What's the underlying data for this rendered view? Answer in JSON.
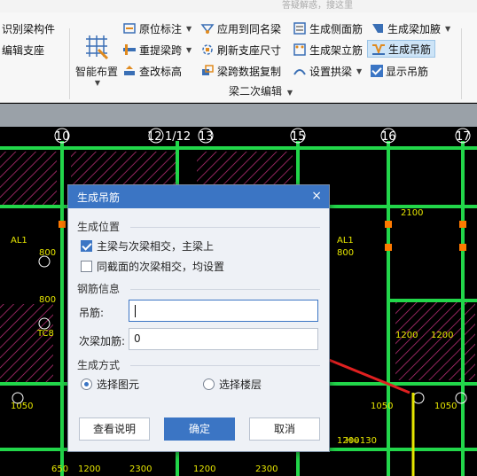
{
  "search": {
    "placeholder": "答疑解惑，搜这里"
  },
  "ribbon": {
    "left": {
      "row1": "识别梁构件",
      "row2": "编辑支座"
    },
    "big_button": "智能布置",
    "col2": [
      "原位标注",
      "重提梁跨",
      "查改标高"
    ],
    "col3": [
      "应用到同名梁",
      "刷新支座尺寸",
      "梁跨数据复制"
    ],
    "col4": [
      "生成侧面筋",
      "生成架立筋",
      "设置拱梁"
    ],
    "col5": [
      "生成梁加腋",
      "生成吊筋",
      "显示吊筋"
    ],
    "group_label": "梁二次编辑",
    "active_item": "生成吊筋"
  },
  "cad": {
    "axis_labels": [
      "10",
      "12",
      "1/12",
      "13",
      "15",
      "16",
      "17"
    ],
    "labels": [
      "AL1",
      "AL1",
      "800",
      "800",
      "800",
      "2100",
      "1050",
      "1050",
      "1200",
      "1200",
      "1050",
      "650",
      "1200",
      "2300",
      "1200",
      "2300",
      "H=130",
      "TC8",
      "1200"
    ],
    "colors": {
      "beam": "#22d64a",
      "hatch": "#c0307a",
      "text": "#e6e600",
      "axis": "#ffffff"
    }
  },
  "dialog": {
    "title": "生成吊筋",
    "close": "×",
    "section_position": "生成位置",
    "opt_main": {
      "label": "主梁与次梁相交，主梁上",
      "checked": true
    },
    "opt_same": {
      "label": "同截面的次梁相交，均设置",
      "checked": false
    },
    "section_rebar": "钢筋信息",
    "field_hanging": {
      "label": "吊筋:",
      "value": ""
    },
    "field_secondary": {
      "label": "次梁加筋:",
      "value": "0"
    },
    "section_mode": "生成方式",
    "radio_element": {
      "label": "选择图元",
      "selected": true
    },
    "radio_floor": {
      "label": "选择楼层",
      "selected": false
    },
    "btn_help": "查看说明",
    "btn_ok": "确定",
    "btn_cancel": "取消"
  }
}
